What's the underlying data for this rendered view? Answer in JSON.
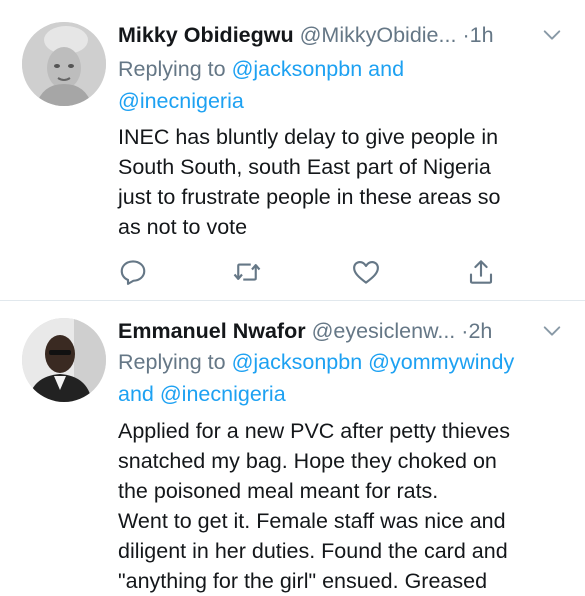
{
  "tweets": [
    {
      "name": "Mikky Obidiegwu",
      "handle": "@MikkyObidie...",
      "dot": "·",
      "time": "1h",
      "reply_prefix": "Replying to",
      "reply_mention1": "@jacksonpbn",
      "reply_and": "and",
      "reply_mention2": "@inecnigeria",
      "lines": [
        "INEC has bluntly delay to give people in",
        "South South, south East part of Nigeria",
        "just to frustrate people in these areas so",
        "as not to vote"
      ]
    },
    {
      "name": "Emmanuel Nwafor",
      "handle": "@eyesiclenw...",
      "dot": "·",
      "time": "2h",
      "reply_prefix": "Replying to",
      "reply_mention1": "@jacksonpbn",
      "reply_mention2": "@yommywindy",
      "reply_and": "and",
      "reply_mention3": "@inecnigeria",
      "lines": [
        "Applied for a new PVC after petty thieves",
        "snatched my bag. Hope they choked on",
        "the poisoned meal meant for rats.",
        "Went to get it. Female staff was nice and",
        "diligent in her duties. Found the card and",
        "\"anything for the girl\" ensued. Greased"
      ]
    }
  ],
  "icons": [
    "reply-icon",
    "retweet-icon",
    "like-icon",
    "share-icon",
    "chevron-down-icon"
  ],
  "colors": {
    "link": "#1da1f2",
    "muted": "#657786",
    "text": "#14171a",
    "divider": "#e1e8ed"
  }
}
